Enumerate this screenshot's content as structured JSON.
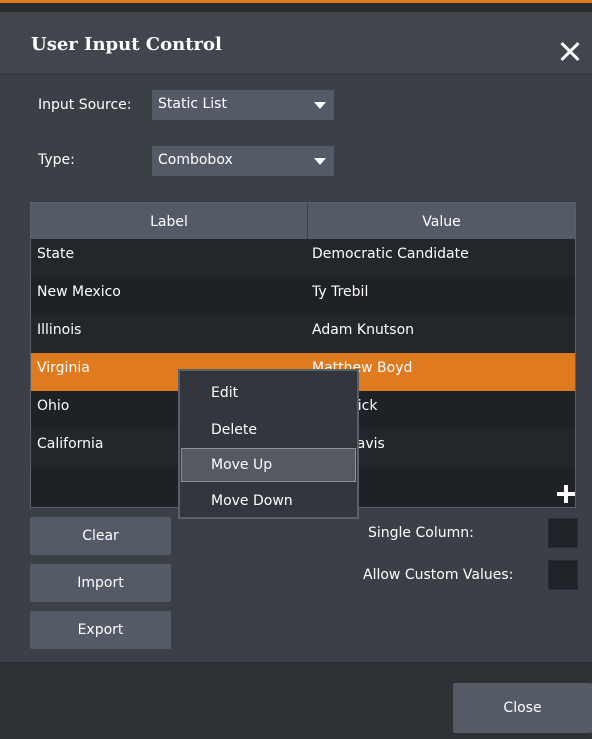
{
  "dialog": {
    "title": "User Input Control",
    "accent_color": "#e07a1f"
  },
  "form": {
    "input_source_label": "Input Source:",
    "input_source_value": "Static List",
    "type_label": "Type:",
    "type_value": "Combobox"
  },
  "table": {
    "columns": [
      "Label",
      "Value"
    ],
    "rows": [
      {
        "label": "State",
        "value": "Democratic Candidate"
      },
      {
        "label": "New Mexico",
        "value": "Ty Trebil"
      },
      {
        "label": "Illinois",
        "value": "Adam Knutson"
      },
      {
        "label": "Virginia",
        "value": "Matthew Boyd"
      },
      {
        "label": "Ohio",
        "value": "rick"
      },
      {
        "label": "California",
        "value": "Davis"
      }
    ],
    "selected_row": 3,
    "add_icon": "plus-icon"
  },
  "context_menu": {
    "items": [
      "Edit",
      "Delete",
      "Move Up",
      "Move Down"
    ],
    "hovered_item": "Move Up"
  },
  "buttons": {
    "clear": "Clear",
    "import": "Import",
    "export": "Export",
    "close": "Close"
  },
  "options": {
    "single_column_label": "Single Column:",
    "allow_custom_values_label": "Allow Custom Values:"
  }
}
